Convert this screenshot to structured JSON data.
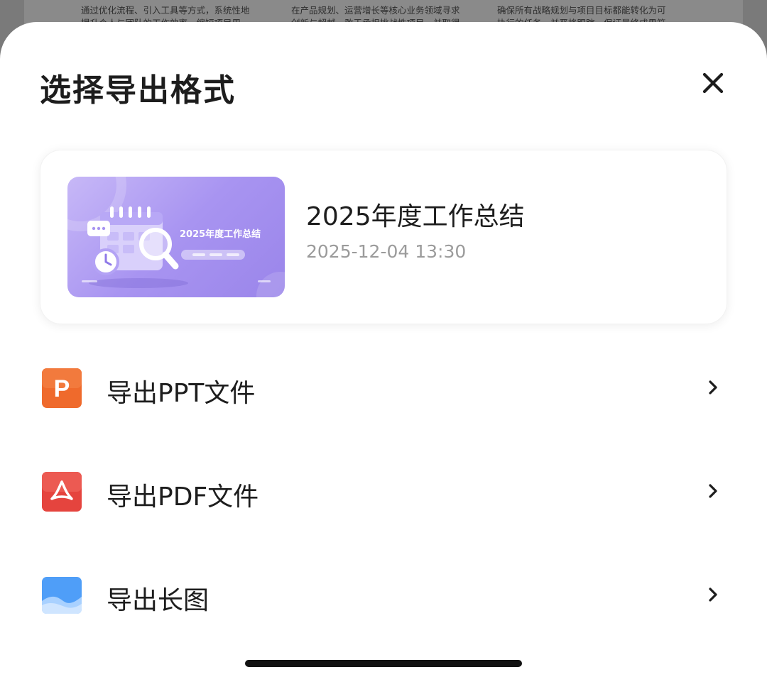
{
  "background": {
    "columns": [
      {
        "line1": "通过优化流程、引入工具等方式，系统性地",
        "line2": "提升个人与团队的工作效率，缩短项目周"
      },
      {
        "line1": "在产品规划、运营增长等核心业务领域寻求",
        "line2": "创新与超越，敢于承担挑战性项目，并取得"
      },
      {
        "line1": "确保所有战略规划与项目目标都能转化为可",
        "line2": "执行的任务，并严格跟踪，保证最终成果符"
      }
    ]
  },
  "sheet": {
    "title": "选择导出格式",
    "close_icon": "close-icon"
  },
  "document": {
    "name": "2025年度工作总结",
    "time": "2025-12-04 13:30",
    "thumbnail": {
      "title": "2025年度工作总结",
      "accent": "#a894f1"
    }
  },
  "options": [
    {
      "label": "导出PPT文件",
      "icon": "ppt-file-icon",
      "color": "#ef6a2c"
    },
    {
      "label": "导出PDF文件",
      "icon": "pdf-file-icon",
      "color": "#e5443e"
    },
    {
      "label": "导出长图",
      "icon": "image-icon",
      "color": "#4f9ef8"
    }
  ]
}
